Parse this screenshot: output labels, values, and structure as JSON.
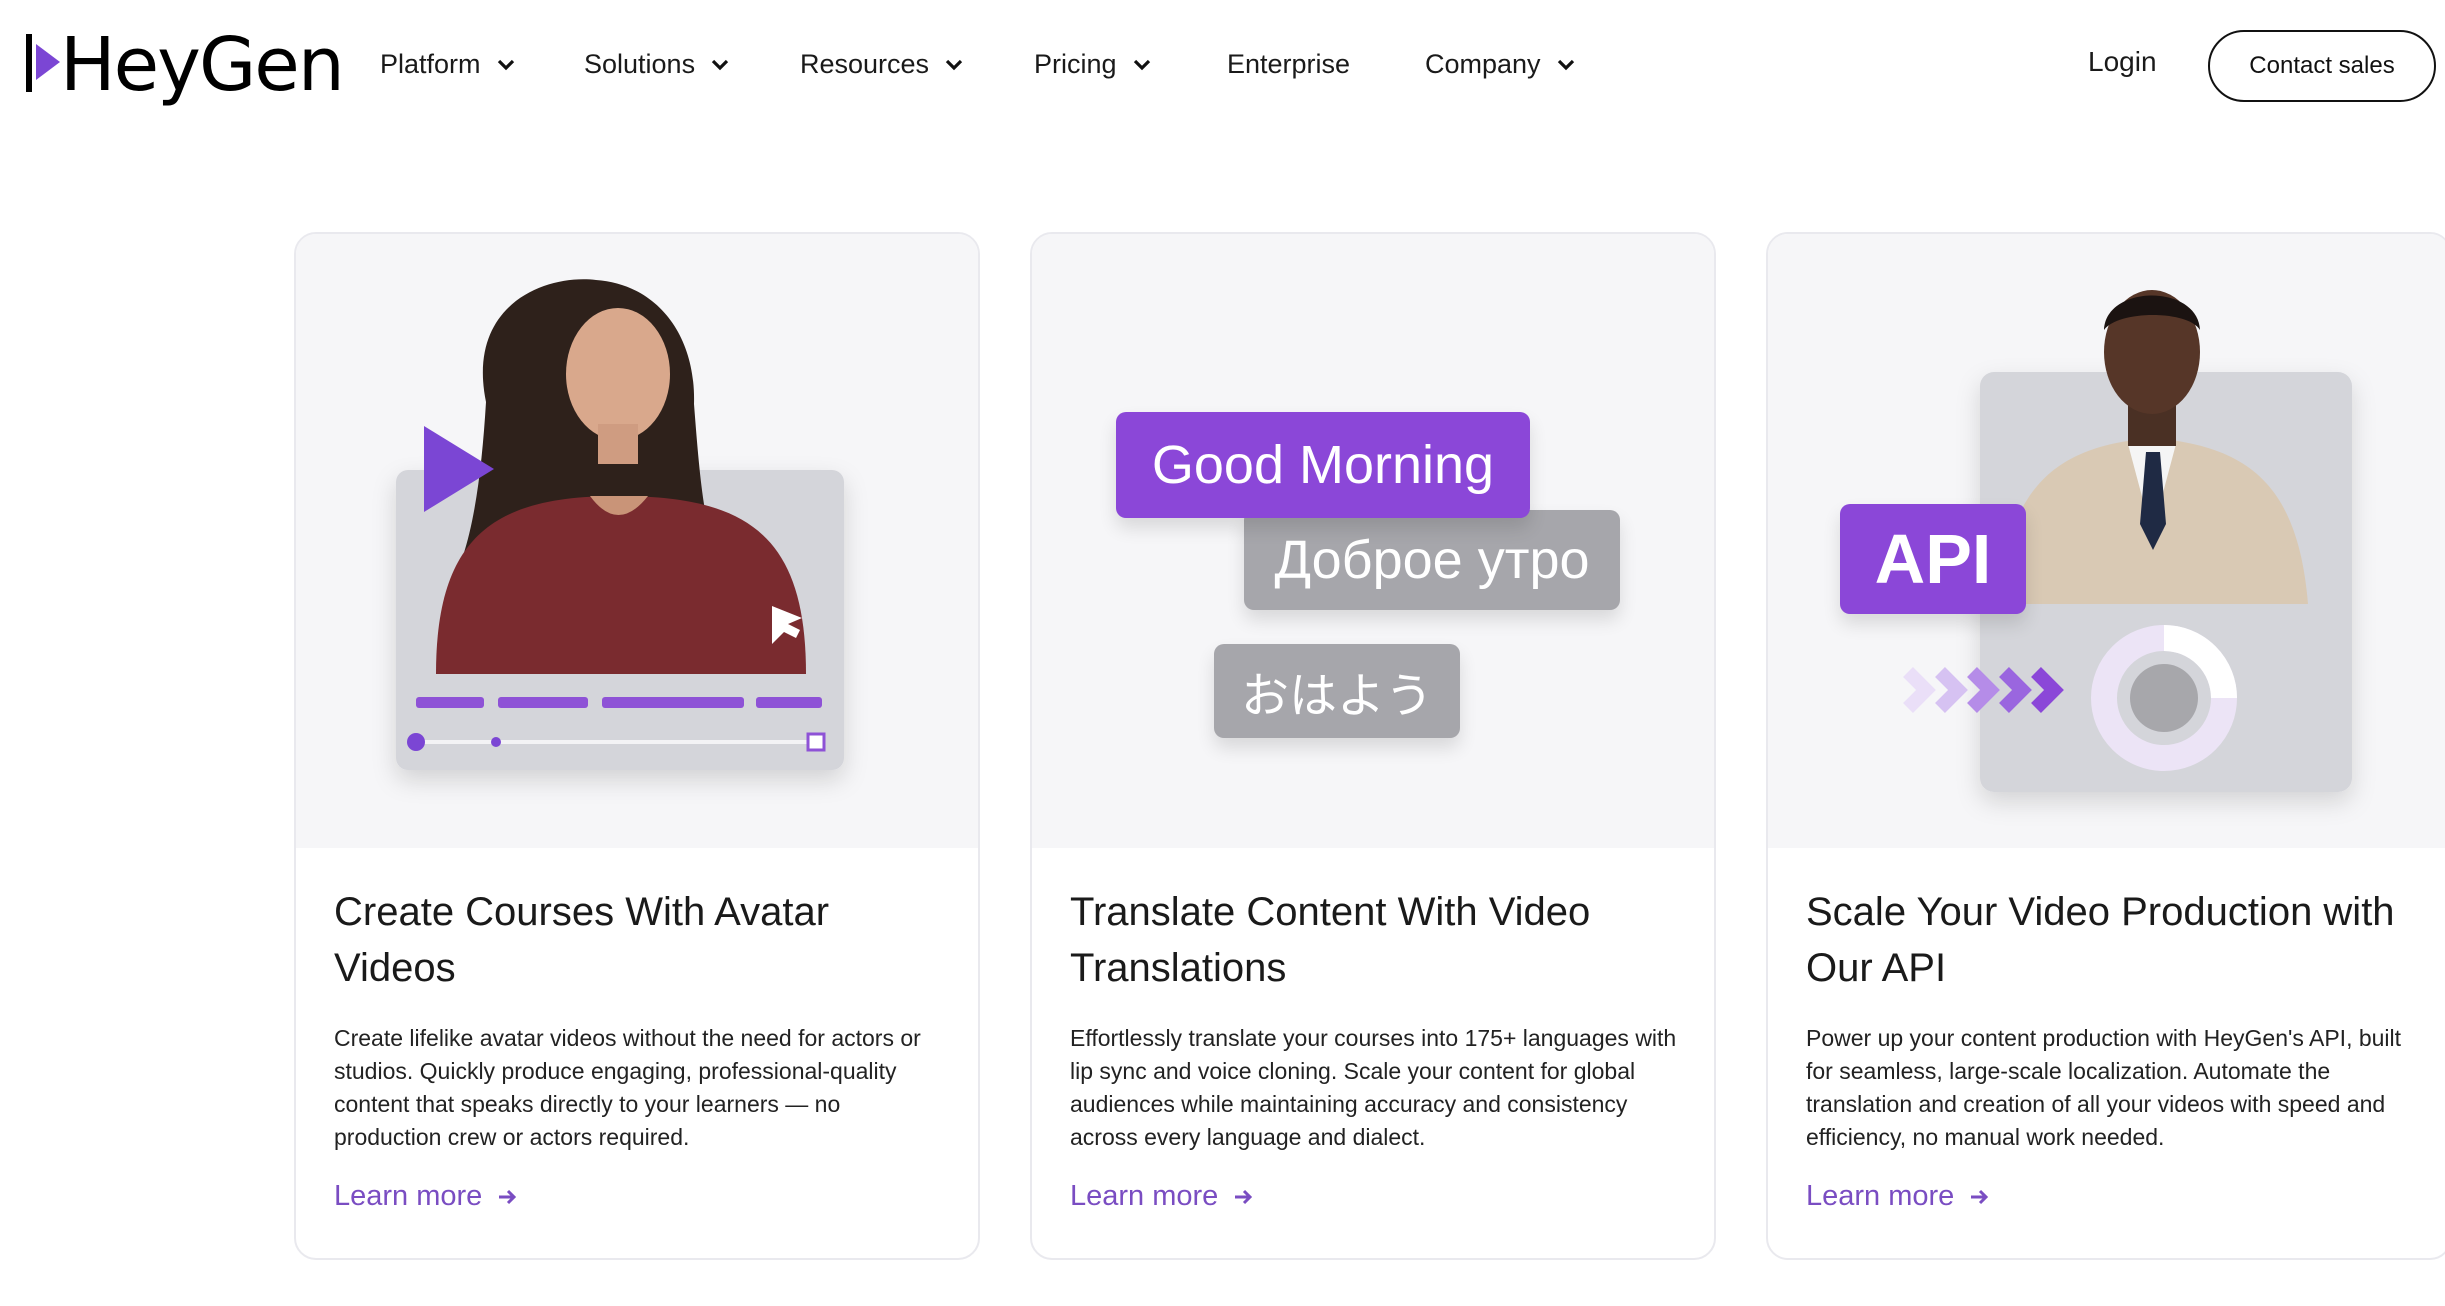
{
  "brand": {
    "name": "HeyGen",
    "accent": "#7b46d4",
    "link_color": "#7a4dc2"
  },
  "nav": {
    "items": [
      {
        "label": "Platform",
        "has_dropdown": true
      },
      {
        "label": "Solutions",
        "has_dropdown": true
      },
      {
        "label": "Resources",
        "has_dropdown": true
      },
      {
        "label": "Pricing",
        "has_dropdown": true
      },
      {
        "label": "Enterprise",
        "has_dropdown": false
      },
      {
        "label": "Company",
        "has_dropdown": true
      }
    ],
    "login": "Login",
    "contact_sales": "Contact sales"
  },
  "cards": [
    {
      "title": "Create Courses With Avatar Videos",
      "description": "Create lifelike avatar videos without the need for actors or studios. Quickly produce engaging, professional-quality content that speaks directly to your learners — no production crew or actors required.",
      "link": "Learn more"
    },
    {
      "title": "Translate Content With Video Translations",
      "description": "Effortlessly translate your courses into 175+ languages with lip sync and voice cloning. Scale your content for global audiences while maintaining accuracy and consistency across every language and dialect.",
      "link": "Learn more",
      "pills": [
        "Good Morning",
        "Доброе утро",
        "おはよう"
      ]
    },
    {
      "title": "Scale Your Video Production with Our API",
      "description": "Power up your content production with HeyGen's API, built for seamless, large-scale localization. Automate the translation and creation of all your videos with speed and efficiency, no manual work needed.",
      "link": "Learn more",
      "badge": "API"
    }
  ]
}
